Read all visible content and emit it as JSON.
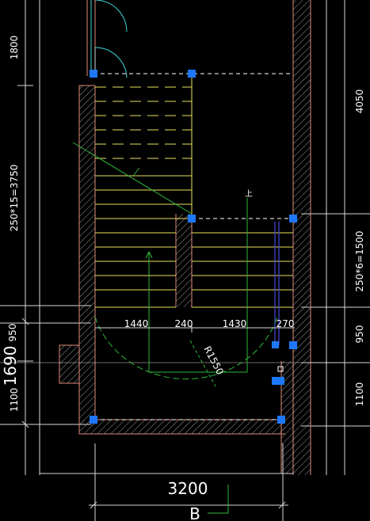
{
  "drawing": {
    "left_dims": [
      "1800",
      "250*15=3750",
      "950",
      "1100",
      "1690"
    ],
    "right_dims": [
      "4050",
      "250*6=1500",
      "950",
      "1100"
    ],
    "width_dims": [
      "1440",
      "240",
      "1430",
      "270"
    ],
    "radius_label": "R1550",
    "overall_width": "3200",
    "axis_label": "B",
    "stair_up_mark": "上"
  },
  "colors": {
    "background": "#000000",
    "wall": "#e08a7a",
    "tread": "#e8e060",
    "dimension": "#d8d8d8",
    "leader": "#2fb83a",
    "door": "#3fd6d6",
    "grip": "#1e78ff"
  }
}
